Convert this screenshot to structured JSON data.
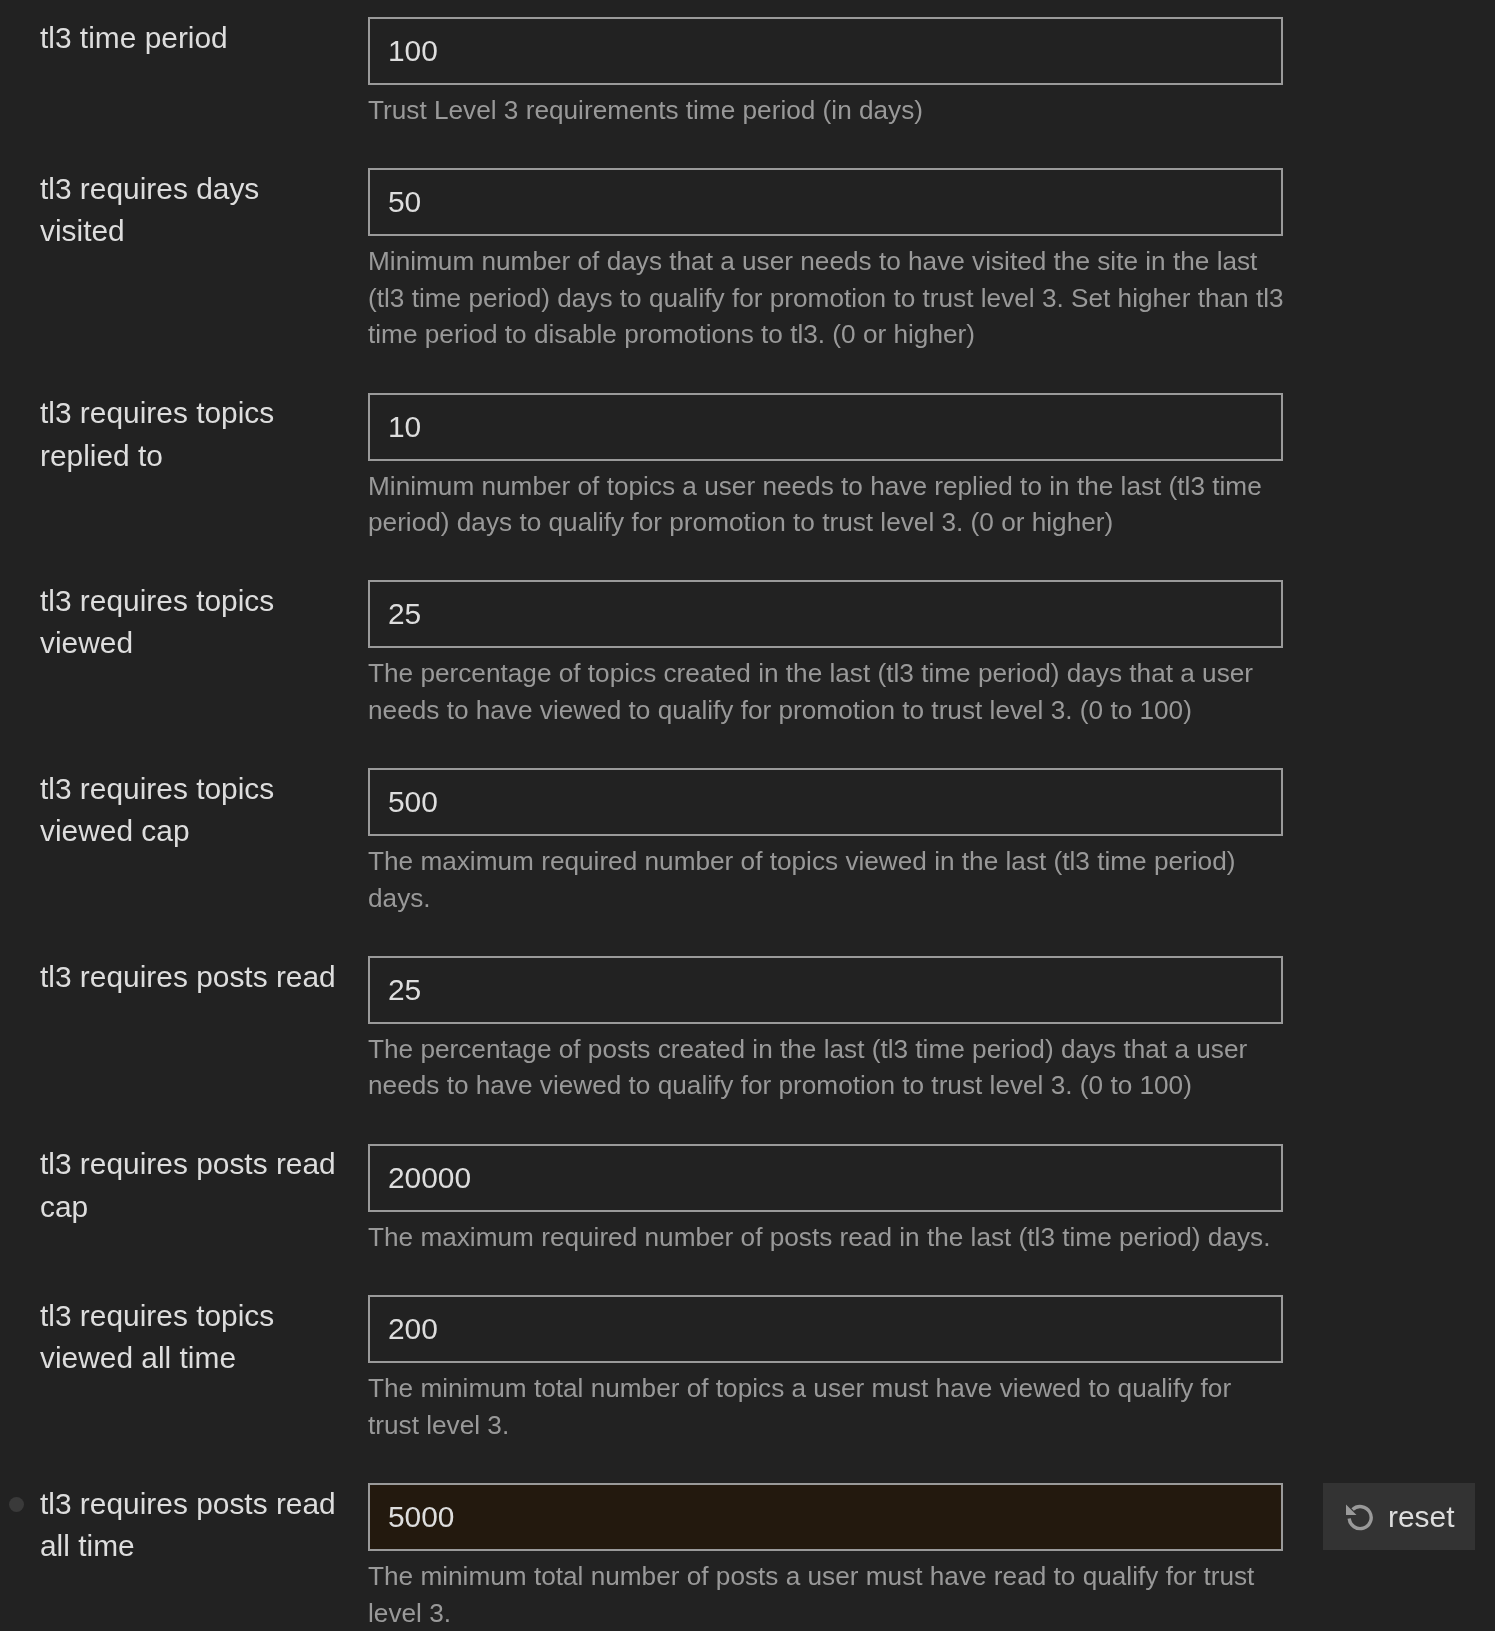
{
  "settings": [
    {
      "label": "tl3 time period",
      "value": "100",
      "description": "Trust Level 3 requirements time period (in days)",
      "modified": false
    },
    {
      "label": "tl3 requires days visited",
      "value": "50",
      "description": "Minimum number of days that a user needs to have visited the site in the last (tl3 time period) days to qualify for promotion to trust level 3. Set higher than tl3 time period to disable promotions to tl3. (0 or higher)",
      "modified": false
    },
    {
      "label": "tl3 requires topics replied to",
      "value": "10",
      "description": "Minimum number of topics a user needs to have replied to in the last (tl3 time period) days to qualify for promotion to trust level 3. (0 or higher)",
      "modified": false
    },
    {
      "label": "tl3 requires topics viewed",
      "value": "25",
      "description": "The percentage of topics created in the last (tl3 time period) days that a user needs to have viewed to qualify for promotion to trust level 3. (0 to 100)",
      "modified": false
    },
    {
      "label": "tl3 requires topics viewed cap",
      "value": "500",
      "description": "The maximum required number of topics viewed in the last (tl3 time period) days.",
      "modified": false
    },
    {
      "label": "tl3 requires posts read",
      "value": "25",
      "description": "The percentage of posts created in the last (tl3 time period) days that a user needs to have viewed to qualify for promotion to trust level 3. (0 to 100)",
      "modified": false
    },
    {
      "label": "tl3 requires posts read cap",
      "value": "20000",
      "description": "The maximum required number of posts read in the last (tl3 time period) days.",
      "modified": false
    },
    {
      "label": "tl3 requires topics viewed all time",
      "value": "200",
      "description": "The minimum total number of topics a user must have viewed to qualify for trust level 3.",
      "modified": false
    },
    {
      "label": "tl3 requires posts read all time",
      "value": "5000",
      "description": "The minimum total number of posts a user must have read to qualify for trust level 3.",
      "modified": true,
      "reset_button": "reset"
    }
  ]
}
